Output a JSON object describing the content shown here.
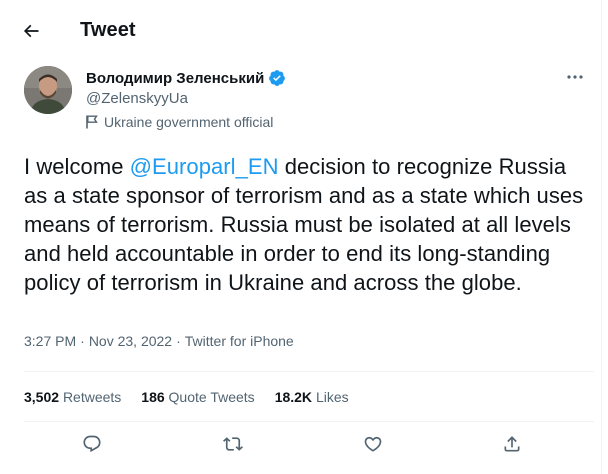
{
  "header": {
    "title": "Tweet"
  },
  "author": {
    "display_name": "Володимир Зеленський",
    "handle": "@ZelenskyyUa",
    "label": "Ukraine government official",
    "verified": true
  },
  "tweet": {
    "text_before": "I welcome ",
    "mention": "@Europarl_EN",
    "text_after": " decision to recognize Russia as a state sponsor of terrorism and as a state which uses means of terrorism. Russia must be isolated at all levels and held accountable in order to end its long-standing policy of terrorism in Ukraine and across the globe."
  },
  "meta": {
    "time": "3:27 PM",
    "separator1": "·",
    "date": "Nov 23, 2022",
    "separator2": "·",
    "source": "Twitter for iPhone"
  },
  "stats": {
    "retweets": {
      "count": "3,502",
      "label": "Retweets"
    },
    "quotes": {
      "count": "186",
      "label": "Quote Tweets"
    },
    "likes": {
      "count": "18.2K",
      "label": "Likes"
    }
  },
  "colors": {
    "accent": "#1d9bf0",
    "secondary_text": "#536471",
    "primary_text": "#0f1419",
    "divider": "#eff3f4"
  },
  "icons": {
    "back": "arrow-left-icon",
    "verified": "verified-badge-icon",
    "label": "flag-icon",
    "more": "more-dots-icon",
    "reply": "reply-icon",
    "retweet": "retweet-icon",
    "like": "like-heart-icon",
    "share": "share-icon"
  }
}
